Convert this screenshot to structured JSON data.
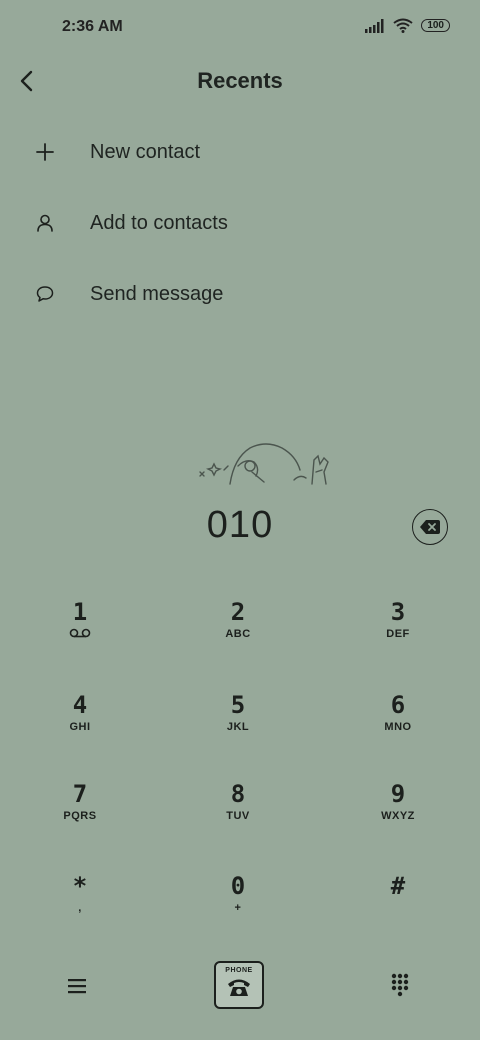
{
  "status_bar": {
    "time": "2:36 AM",
    "battery": "100"
  },
  "header": {
    "title": "Recents"
  },
  "menu": [
    {
      "label": "New contact",
      "icon": "plus-icon"
    },
    {
      "label": "Add to contacts",
      "icon": "person-icon"
    },
    {
      "label": "Send message",
      "icon": "chat-bubble-icon"
    }
  ],
  "dialer": {
    "number": "010"
  },
  "keys": [
    {
      "digit": "1",
      "letters": ""
    },
    {
      "digit": "2",
      "letters": "ABC"
    },
    {
      "digit": "3",
      "letters": "DEF"
    },
    {
      "digit": "4",
      "letters": "GHI"
    },
    {
      "digit": "5",
      "letters": "JKL"
    },
    {
      "digit": "6",
      "letters": "MNO"
    },
    {
      "digit": "7",
      "letters": "PQRS"
    },
    {
      "digit": "8",
      "letters": "TUV"
    },
    {
      "digit": "9",
      "letters": "WXYZ"
    },
    {
      "digit": "*",
      "letters": ","
    },
    {
      "digit": "0",
      "letters": "+"
    },
    {
      "digit": "#",
      "letters": ""
    }
  ],
  "bottom_nav": {
    "call_label": "PHONE"
  },
  "colors": {
    "background": "#97a99a",
    "foreground": "#1c201d"
  }
}
